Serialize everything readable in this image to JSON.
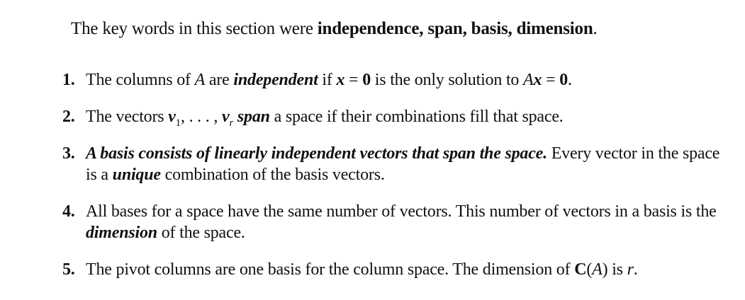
{
  "intro": {
    "prefix": "The key words in this section were ",
    "keywords": "independence, span, basis, dimension",
    "suffix": "."
  },
  "items": [
    {
      "num": "1.",
      "t1": "The columns of ",
      "A": "A",
      "t2": " are ",
      "em1": "independent",
      "t3": " if ",
      "x1": "x",
      "eq1": " = ",
      "zero1": "0",
      "t4": " is the only solution to ",
      "A2": "A",
      "x2": "x",
      "eq2": " = ",
      "zero2": "0",
      "t5": "."
    },
    {
      "num": "2.",
      "t1": "The vectors ",
      "v": "v",
      "sub1": "1",
      "dots": ", . . . , ",
      "v2": "v",
      "subr": "r",
      "sp": " ",
      "em1": "span",
      "t2": " a space if their combinations fill that space."
    },
    {
      "num": "3.",
      "em1": "A basis consists of linearly independent vectors that span the space.",
      "t1": " Every vector in the space is a ",
      "em2": "unique",
      "t2": " combination of the basis vectors."
    },
    {
      "num": "4.",
      "t1": "All bases for a space have the same number of vectors. This number of vectors in a basis is the ",
      "em1": "dimension",
      "t2": " of the space."
    },
    {
      "num": "5.",
      "t1": "The pivot columns are one basis for the column space. The dimension of ",
      "C": "C",
      "paren1": "(",
      "A": "A",
      "paren2": ")",
      "t2": " is ",
      "r": "r",
      "t3": "."
    }
  ]
}
